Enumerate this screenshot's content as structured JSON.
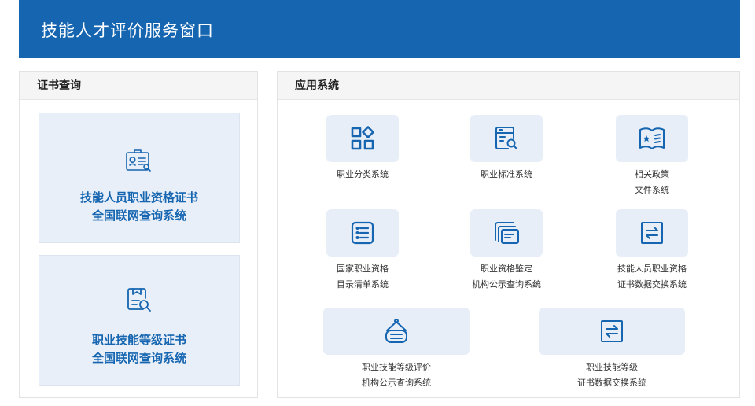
{
  "header": {
    "title": "技能人才评价服务窗口"
  },
  "certificate_query": {
    "title": "证书查询",
    "cards": [
      {
        "line1": "技能人员职业资格证书",
        "line2": "全国联网查询系统",
        "icon": "certificate-search-icon"
      },
      {
        "line1": "职业技能等级证书",
        "line2": "全国联网查询系统",
        "icon": "document-search-icon"
      }
    ]
  },
  "app_systems": {
    "title": "应用系统",
    "items": [
      {
        "line1": "职业分类系统",
        "line2": "",
        "icon": "category-grid-icon"
      },
      {
        "line1": "职业标准系统",
        "line2": "",
        "icon": "standard-search-icon"
      },
      {
        "line1": "相关政策",
        "line2": "文件系统",
        "icon": "policy-book-icon"
      },
      {
        "line1": "国家职业资格",
        "line2": "目录清单系统",
        "icon": "list-icon"
      },
      {
        "line1": "职业资格鉴定",
        "line2": "机构公示查询系统",
        "icon": "stacked-docs-icon"
      },
      {
        "line1": "技能人员职业资格",
        "line2": "证书数据交换系统",
        "icon": "exchange-icon"
      },
      {
        "line1": "职业技能等级评价",
        "line2": "机构公示查询系统",
        "icon": "institution-sign-icon"
      },
      {
        "line1": "职业技能等级",
        "line2": "证书数据交换系统",
        "icon": "exchange-icon"
      }
    ]
  },
  "colors": {
    "primary": "#1565b0",
    "tile_bg": "#e8eef8",
    "panel_head_bg": "#f5f5f5"
  }
}
